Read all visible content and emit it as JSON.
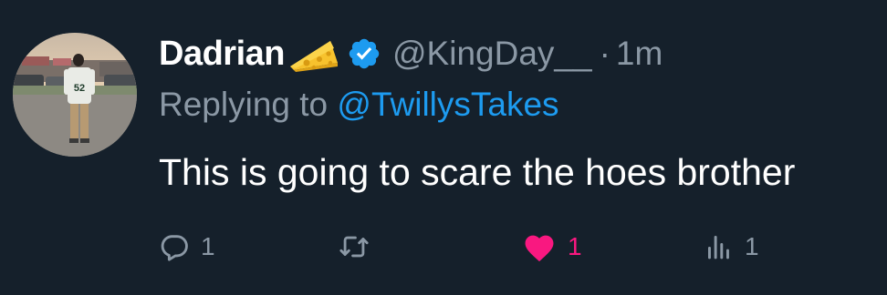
{
  "author": {
    "display_name": "Dadrian",
    "emoji_icon": "cheese-icon",
    "verified_icon": "verified-badge-icon",
    "handle": "@KingDay__",
    "separator": "·",
    "time": "1m"
  },
  "reply_context": {
    "prefix": "Replying to ",
    "mention": "@TwillysTakes"
  },
  "tweet": {
    "text": "This is going to scare the hoes brother"
  },
  "actions": {
    "reply": {
      "icon": "reply-icon",
      "count": "1"
    },
    "retweet": {
      "icon": "retweet-icon",
      "count": ""
    },
    "like": {
      "icon": "heart-icon",
      "count": "1",
      "active": true
    },
    "views": {
      "icon": "views-icon",
      "count": "1"
    }
  },
  "colors": {
    "background": "#15202b",
    "primary_text": "#ffffff",
    "secondary_text": "#8b98a5",
    "accent_blue": "#1d9bf0",
    "like_pink": "#f91880"
  }
}
